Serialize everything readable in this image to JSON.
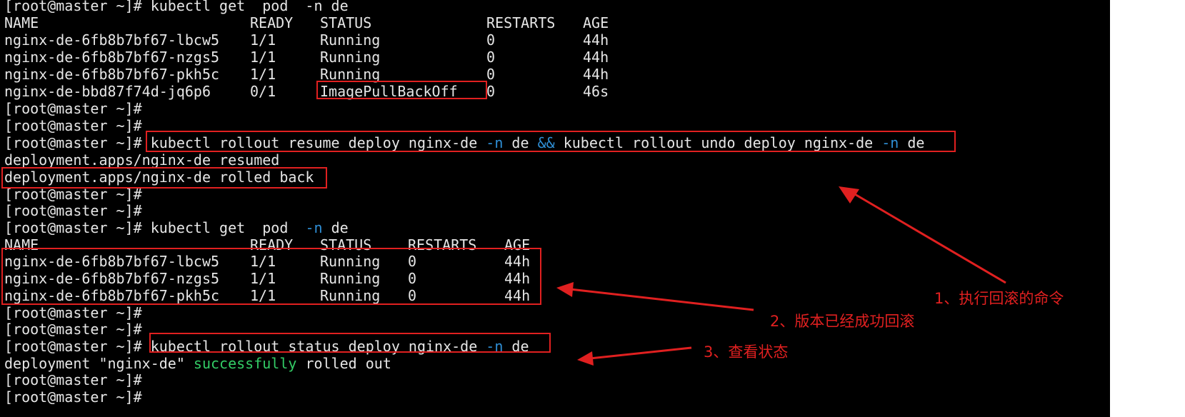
{
  "prompt": "[root@master ~]#",
  "annotation_color": "#e02020",
  "section1": {
    "command": " kubectl get  pod  -n de",
    "header": [
      "NAME",
      "READY",
      "STATUS",
      "RESTARTS",
      "AGE"
    ],
    "rows": [
      [
        "nginx-de-6fb8b7bf67-lbcw5",
        "1/1",
        "Running",
        "0",
        "44h"
      ],
      [
        "nginx-de-6fb8b7bf67-nzgs5",
        "1/1",
        "Running",
        "0",
        "44h"
      ],
      [
        "nginx-de-6fb8b7bf67-pkh5c",
        "1/1",
        "Running",
        "0",
        "44h"
      ],
      [
        "nginx-de-bbd87f74d-jq6p6",
        "0/1",
        "ImagePullBackOff",
        "0",
        "46s"
      ]
    ]
  },
  "rollout": {
    "command_part1": " kubectl rollout resume deploy nginx-de ",
    "flag": "-n",
    "command_part2": " de ",
    "andand": "&&",
    "command_part3": " kubectl rollout undo deploy nginx-de ",
    "command_part4": " de",
    "output1": "deployment.apps/nginx-de resumed",
    "output2": "deployment.apps/nginx-de rolled back"
  },
  "section2": {
    "command": " kubectl get  pod  ",
    "flag": "-n",
    "command_tail": " de",
    "header": [
      "NAME",
      "READY",
      "STATUS",
      "RESTARTS",
      "AGE"
    ],
    "rows": [
      [
        "nginx-de-6fb8b7bf67-lbcw5",
        "1/1",
        "Running",
        "0",
        "44h"
      ],
      [
        "nginx-de-6fb8b7bf67-nzgs5",
        "1/1",
        "Running",
        "0",
        "44h"
      ],
      [
        "nginx-de-6fb8b7bf67-pkh5c",
        "1/1",
        "Running",
        "0",
        "44h"
      ]
    ]
  },
  "status": {
    "command": " kubectl rollout status deploy nginx-de ",
    "flag": "-n",
    "command_tail": " de",
    "out_part1": "deployment \"nginx-de\" ",
    "out_success": "successfully",
    "out_part2": " rolled out"
  },
  "annotations": {
    "note1": "1、执行回滚的命令",
    "note2": "2、版本已经成功回滚",
    "note3": "3、查看状态"
  }
}
